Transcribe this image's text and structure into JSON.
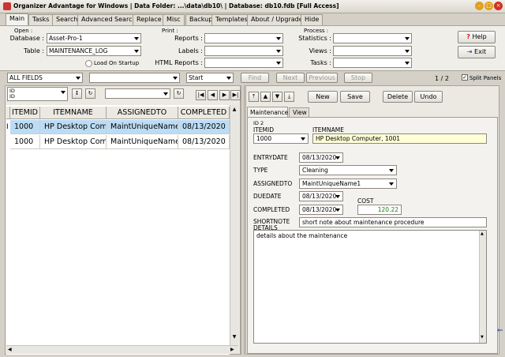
{
  "window": {
    "title": "Organizer Advantage for Windows | Data Folder: ...\\data\\db10\\ | Database: db10.fdb [Full Access]"
  },
  "menu_tabs": [
    "Main",
    "Tasks",
    "Search",
    "Advanced Search",
    "Replace",
    "Misc",
    "Backup",
    "Templates",
    "About / Upgrade",
    "Hide"
  ],
  "ribbon": {
    "open": {
      "group_title": "Open :",
      "database_label": "Database :",
      "database_value": "Asset-Pro-1",
      "table_label": "Table :",
      "table_value": "MAINTENANCE_LOG",
      "load_on_startup": "Load On Startup"
    },
    "print": {
      "group_title": "Print :",
      "reports_label": "Reports :",
      "labels_label": "Labels :",
      "html_reports_label": "HTML Reports :"
    },
    "process": {
      "group_title": "Process :",
      "statistics_label": "Statistics :",
      "views_label": "Views :",
      "tasks_label": "Tasks :"
    },
    "help_label": "Help",
    "exit_label": "Exit"
  },
  "search_bar": {
    "field_value": "ALL FIELDS",
    "search_text": "",
    "mode_value": "Start",
    "find_label": "Find",
    "next_label": "Next",
    "previous_label": "Previous",
    "stop_label": "Stop",
    "page_count": "1 / 2",
    "split_panels": "Split Panels"
  },
  "sort_bar": {
    "sort_field": "ID",
    "sort_field_sub": "ID"
  },
  "grid": {
    "columns": [
      "ITEMID",
      "ITEMNAME",
      "ASSIGNEDTO",
      "COMPLETED"
    ],
    "rows": [
      [
        "1000",
        "HP Desktop Comp",
        "MaintUniqueName1",
        "08/13/2020"
      ],
      [
        "1000",
        "HP Desktop Comp",
        "MaintUniqueName1",
        "08/13/2020"
      ]
    ],
    "row_indicator": "I"
  },
  "record_toolbar": {
    "new_label": "New",
    "save_label": "Save",
    "delete_label": "Delete",
    "undo_label": "Undo"
  },
  "form_tabs": [
    "Maintenance",
    "View"
  ],
  "form": {
    "id_label": "ID 2",
    "itemid_label": "ITEMID",
    "itemid_value": "1000",
    "itemname_label": "ITEMNAME",
    "itemname_value": "HP Desktop Computer, 1001",
    "entrydate_label": "ENTRYDATE",
    "entrydate_value": "08/13/2020",
    "type_label": "TYPE",
    "type_value": "Cleaning",
    "assignedto_label": "ASSIGNEDTO",
    "assignedto_value": "MaintUniqueName1",
    "duedate_label": "DUEDATE",
    "duedate_value": "08/13/2020",
    "cost_label": "COST",
    "completed_label": "COMPLETED",
    "completed_value": "08/13/2020",
    "cost_value": "120.22",
    "shortnote_label": "SHORTNOTE",
    "shortnote_value": "short note about maintenance procedure",
    "details_label": "DETAILS",
    "details_value": "details about the maintenance"
  },
  "colors": {
    "selection": "#bcdcf4",
    "itemname_bg": "#ffffd8",
    "cost_text": "#1a7a1a"
  }
}
